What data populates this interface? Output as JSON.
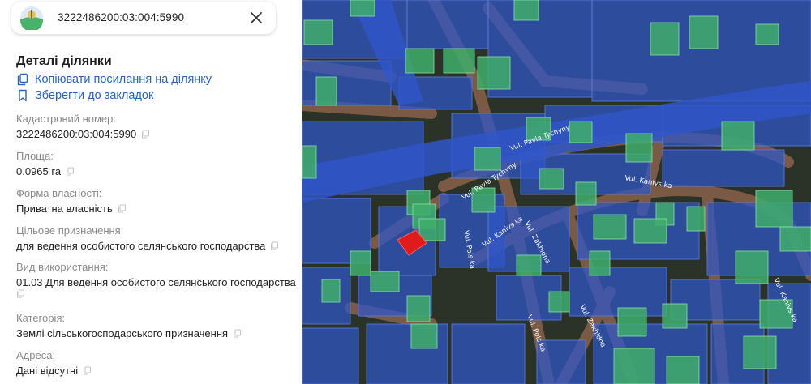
{
  "search": {
    "value": "3222486200:03:004:5990"
  },
  "details": {
    "title": "Деталі ділянки",
    "copy_link_label": "Копіювати посилання на ділянку",
    "bookmark_label": "Зберегти до закладок",
    "fields": [
      {
        "label": "Кадастровий номер:",
        "value": "3222486200:03:004:5990"
      },
      {
        "label": "Площа:",
        "value": "0.0965 га"
      },
      {
        "label": "Форма власності:",
        "value": "Приватна власність"
      },
      {
        "label": "Цільове призначення:",
        "value": "для ведення особистого селянського господарства"
      },
      {
        "label": "Вид використання:",
        "value": "01.03 Для ведення особистого селянського господарства"
      },
      {
        "label": "Категорія:",
        "value": "Землі сільськогосподарського призначення"
      },
      {
        "label": "Адреса:",
        "value": "Дані відсутні"
      }
    ]
  },
  "map": {
    "streets": [
      "Vul. Pavla Tychyny",
      "Vul. Pavla Tychyny",
      "Vul. Kanivs ka",
      "Vul. Kanivs ka",
      "Vul. Kanivs ka",
      "Vul. Zakhidna",
      "Vul. Zakhidna",
      "Vul. Pols ka",
      "Vul. Pols ka"
    ],
    "colors": {
      "state": "#2f56c9",
      "private": "#3fae6a",
      "selected": "#e01b1b",
      "accent": "#2563c9"
    }
  }
}
